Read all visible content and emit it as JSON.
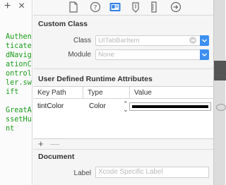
{
  "navigator": {
    "add_symbol": "+",
    "close_symbol": "×",
    "code_lines": [
      "AuthenticatedNavigationController.swift",
      "",
      "GreatAssetHunt"
    ]
  },
  "inspector": {
    "tabs": [
      "file-icon",
      "help-icon",
      "identity-icon",
      "attributes-icon",
      "size-icon",
      "connections-icon"
    ],
    "custom_class": {
      "title": "Custom Class",
      "class_label": "Class",
      "class_placeholder": "UITabBarItem",
      "module_label": "Module",
      "module_placeholder": "None"
    },
    "runtime_attributes": {
      "title": "User Defined Runtime Attributes",
      "columns": [
        "Key Path",
        "Type",
        "Value"
      ],
      "rows": [
        {
          "key_path": "tintColor",
          "type": "Color",
          "value": "#000000"
        }
      ],
      "add_label": "+",
      "remove_label": "—"
    },
    "document": {
      "title": "Document",
      "label_label": "Label",
      "label_placeholder": "Xcode Specific Label"
    }
  },
  "colors": {
    "accent": "#3d8ff0",
    "code_green": "#1a9b1a"
  }
}
